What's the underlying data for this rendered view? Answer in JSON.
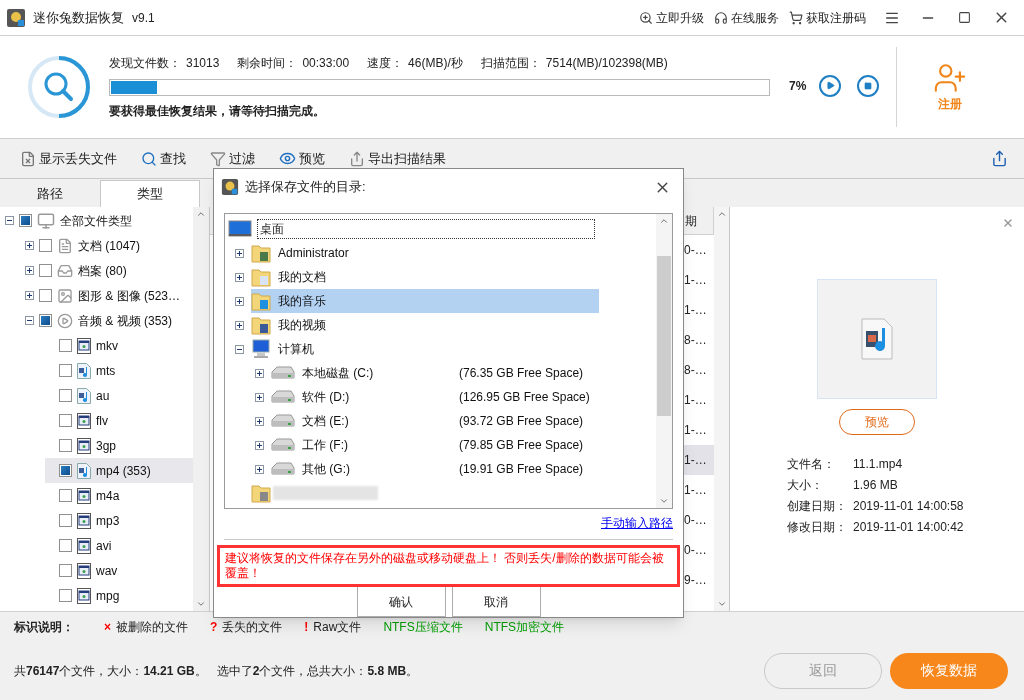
{
  "window": {
    "title": "迷你兔数据恢复",
    "version": "v9.1",
    "links": [
      {
        "kind": "upgrade",
        "label": "立即升级"
      },
      {
        "kind": "service",
        "label": "在线服务"
      },
      {
        "kind": "register",
        "label": "获取注册码"
      }
    ]
  },
  "scan": {
    "stats": [
      {
        "label": "发现文件数：",
        "value": "31013"
      },
      {
        "label": "剩余时间：",
        "value": "00:33:00"
      },
      {
        "label": "速度：",
        "value": "46(MB)/秒"
      },
      {
        "label": "扫描范围：",
        "value": "7514(MB)/102398(MB)"
      }
    ],
    "level": 0.07,
    "percent": "7%",
    "hint": "要获得最佳恢复结果，请等待扫描完成。",
    "register": "注册"
  },
  "toolbar": [
    {
      "kind": "lost",
      "label": "显示丢失文件"
    },
    {
      "kind": "search",
      "label": "查找"
    },
    {
      "kind": "filter",
      "label": "过滤"
    },
    {
      "kind": "preview",
      "label": "预览"
    },
    {
      "kind": "export",
      "label": "导出扫描结果"
    }
  ],
  "tabs": [
    {
      "label": "路径",
      "selected": false
    },
    {
      "label": "类型",
      "selected": true
    }
  ],
  "tree": [
    {
      "label": "全部文件类型",
      "kind": "all",
      "checked": true,
      "expanded": true,
      "selected": false,
      "children": [
        {
          "label": "文档 (1047)",
          "kind": "doc",
          "checked": false,
          "expanded": false,
          "selected": false
        },
        {
          "label": "档案 (80)",
          "kind": "archive",
          "checked": false,
          "expanded": false,
          "selected": false
        },
        {
          "label": "图形 & 图像 (523…",
          "kind": "image",
          "checked": false,
          "expanded": false,
          "selected": false
        },
        {
          "label": "音频 & 视频 (353)",
          "kind": "media",
          "checked": true,
          "expanded": true,
          "selected": false,
          "children": [
            {
              "label": "mkv",
              "kind": "video",
              "checked": false,
              "selected": false
            },
            {
              "label": "mts",
              "kind": "audio",
              "checked": false,
              "selected": false
            },
            {
              "label": "au",
              "kind": "audio",
              "checked": false,
              "selected": false
            },
            {
              "label": "flv",
              "kind": "video",
              "checked": false,
              "selected": false
            },
            {
              "label": "3gp",
              "kind": "video",
              "checked": false,
              "selected": false
            },
            {
              "label": "mp4 (353)",
              "kind": "audio",
              "checked": true,
              "selected": true
            },
            {
              "label": "m4a",
              "kind": "video",
              "checked": false,
              "selected": false
            },
            {
              "label": "mp3",
              "kind": "video",
              "checked": false,
              "selected": false
            },
            {
              "label": "avi",
              "kind": "video",
              "checked": false,
              "selected": false
            },
            {
              "label": "wav",
              "kind": "video",
              "checked": false,
              "selected": false
            },
            {
              "label": "mpg",
              "kind": "video",
              "checked": false,
              "selected": false
            }
          ]
        }
      ]
    }
  ],
  "table": {
    "columns": [
      "期"
    ],
    "rows": [
      {
        "cells": [
          "0-…"
        ],
        "selected": false
      },
      {
        "cells": [
          "1-…"
        ],
        "selected": false
      },
      {
        "cells": [
          "1-…"
        ],
        "selected": false
      },
      {
        "cells": [
          "8-…"
        ],
        "selected": false
      },
      {
        "cells": [
          "8-…"
        ],
        "selected": false
      },
      {
        "cells": [
          "1-…"
        ],
        "selected": false
      },
      {
        "cells": [
          "1-…"
        ],
        "selected": false
      },
      {
        "cells": [
          "1-…"
        ],
        "selected": true
      },
      {
        "cells": [
          "1-…"
        ],
        "selected": false
      },
      {
        "cells": [
          "0-…"
        ],
        "selected": false
      },
      {
        "cells": [
          "0-…"
        ],
        "selected": false
      },
      {
        "cells": [
          "9-…"
        ],
        "selected": false
      }
    ]
  },
  "preview_panel": {
    "button": "预览",
    "info": [
      {
        "label": "文件名：",
        "value": "11.1.mp4"
      },
      {
        "label": "大小：",
        "value": "1.96 MB"
      },
      {
        "label": "创建日期：",
        "value": "2019-11-01 14:00:58"
      },
      {
        "label": "修改日期：",
        "value": "2019-11-01 14:00:42"
      }
    ]
  },
  "legend": {
    "title": "标识说明：",
    "items": [
      {
        "mark": "×",
        "label": "被删除的文件",
        "color": "#ff0000"
      },
      {
        "mark": "?",
        "label": "丢失的文件",
        "color": "#ff0000"
      },
      {
        "mark": "!",
        "label": "Raw文件",
        "color": "#ff0000"
      },
      {
        "label": "NTFS压缩文件",
        "color": "#00a000"
      },
      {
        "label": "NTFS加密文件",
        "color": "#00a000"
      }
    ]
  },
  "status": {
    "total": "共**76147**个文件，大小：**14.21 GB**。",
    "selection": "选中了**2**个文件，总共大小：**5.8 MB**。"
  },
  "buttons": [
    {
      "kind": "back",
      "label": "返回",
      "disabled": true
    },
    {
      "kind": "recover",
      "label": "恢复数据",
      "disabled": false
    }
  ],
  "dialog": {
    "title": "选择保存文件的目录:",
    "root": {
      "label": "桌面",
      "children": [
        {
          "kind": "user",
          "label": "Administrator",
          "expanded": false,
          "selected": false
        },
        {
          "kind": "docs",
          "label": "我的文档",
          "expanded": false,
          "selected": false
        },
        {
          "kind": "music",
          "label": "我的音乐",
          "expanded": false,
          "selected": true
        },
        {
          "kind": "videos",
          "label": "我的视频",
          "expanded": false,
          "selected": false
        },
        {
          "kind": "computer",
          "label": "计算机",
          "expanded": true,
          "selected": false,
          "children": [
            {
              "kind": "drive",
              "label": "本地磁盘 (C:)",
              "free": "(76.35 GB Free Space)",
              "expanded": false,
              "selected": false
            },
            {
              "kind": "drive",
              "label": "软件 (D:)",
              "free": "(126.95 GB Free Space)",
              "expanded": false,
              "selected": false
            },
            {
              "kind": "drive",
              "label": "文档 (E:)",
              "free": "(93.72 GB Free Space)",
              "expanded": false,
              "selected": false
            },
            {
              "kind": "drive",
              "label": "工作 (F:)",
              "free": "(79.85 GB Free Space)",
              "expanded": false,
              "selected": false
            },
            {
              "kind": "drive",
              "label": "其他 (G:)",
              "free": "(19.91 GB Free Space)",
              "expanded": false,
              "selected": false
            }
          ]
        }
      ]
    },
    "link": "手动输入路径",
    "warning": "建议将恢复的文件保存在另外的磁盘或移动硬盘上！ 否则丢失/删除的数据可能会被覆盖！",
    "buttons": [
      "确认",
      "取消"
    ]
  }
}
